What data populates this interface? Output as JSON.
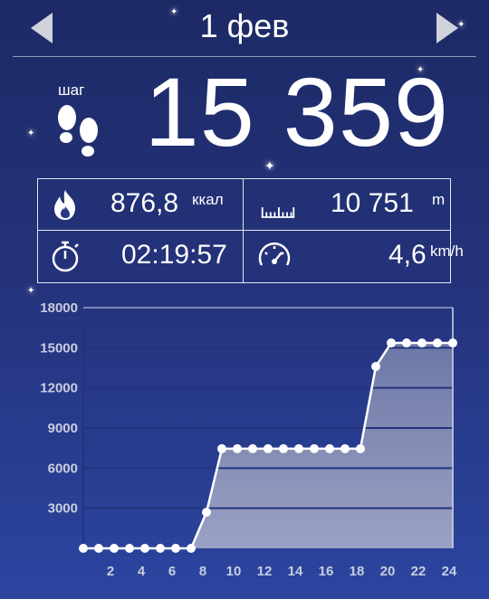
{
  "header": {
    "date": "1 фев",
    "prev_icon": "chevron-left-icon",
    "next_icon": "chevron-right-icon"
  },
  "steps": {
    "label": "шаг",
    "value": "15 359",
    "icon": "footprints-icon"
  },
  "stats": {
    "calories": {
      "value": "876,8",
      "unit": "ккал",
      "icon": "flame-icon"
    },
    "distance": {
      "value": "10 751",
      "unit": "m",
      "icon": "ruler-icon"
    },
    "time": {
      "value": "02:19:57",
      "icon": "stopwatch-icon"
    },
    "speed": {
      "value": "4,6",
      "unit": "km/h",
      "icon": "speedometer-icon"
    }
  },
  "chart_data": {
    "type": "area",
    "x": [
      0,
      1,
      2,
      3,
      4,
      5,
      6,
      7,
      8,
      9,
      10,
      11,
      12,
      13,
      14,
      15,
      16,
      17,
      18,
      19,
      20,
      21,
      22,
      23,
      24
    ],
    "values": [
      0,
      0,
      0,
      0,
      0,
      0,
      0,
      0,
      2700,
      7450,
      7450,
      7450,
      7450,
      7450,
      7450,
      7450,
      7450,
      7450,
      7450,
      13600,
      15359,
      15359,
      15359,
      15359,
      15359
    ],
    "x_tick_labels": [
      "2",
      "4",
      "6",
      "8",
      "10",
      "12",
      "14",
      "16",
      "18",
      "20",
      "22",
      "24"
    ],
    "y_tick_labels": [
      "18000",
      "15000",
      "12000",
      "9000",
      "6000",
      "3000"
    ],
    "ylim": [
      0,
      18000
    ],
    "xlim": [
      0,
      24
    ],
    "grid": true,
    "colors": {
      "line": "#ffffff",
      "fill_top": "#7983ad",
      "fill_bottom": "#aeb2cb",
      "plot_bg": "#2b3d8e",
      "grid": "#24337e",
      "tick_labels": "#c9cde0"
    }
  }
}
